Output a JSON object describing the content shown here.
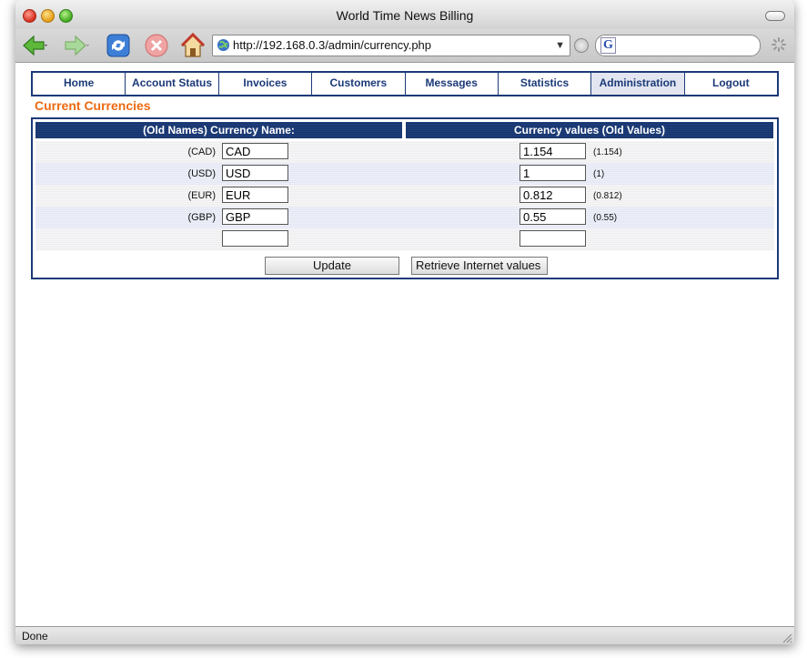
{
  "window": {
    "title": "World Time News Billing"
  },
  "browser": {
    "url": "http://192.168.0.3/admin/currency.php",
    "status": "Done"
  },
  "nav": {
    "items": [
      {
        "label": "Home"
      },
      {
        "label": "Account Status"
      },
      {
        "label": "Invoices"
      },
      {
        "label": "Customers"
      },
      {
        "label": "Messages"
      },
      {
        "label": "Statistics"
      },
      {
        "label": "Administration"
      },
      {
        "label": "Logout"
      }
    ]
  },
  "page": {
    "title": "Current Currencies",
    "col_name_header": "(Old Names) Currency Name:",
    "col_value_header": "Currency values (Old Values)",
    "rows": [
      {
        "old_name": "(CAD)",
        "name": "CAD",
        "value": "1.154",
        "old_value": "(1.154)"
      },
      {
        "old_name": "(USD)",
        "name": "USD",
        "value": "1",
        "old_value": "(1)"
      },
      {
        "old_name": "(EUR)",
        "name": "EUR",
        "value": "0.812",
        "old_value": "(0.812)"
      },
      {
        "old_name": "(GBP)",
        "name": "GBP",
        "value": "0.55",
        "old_value": "(0.55)"
      },
      {
        "old_name": "",
        "name": "",
        "value": "",
        "old_value": ""
      }
    ],
    "update_label": "Update",
    "retrieve_label": "Retrieve Internet values"
  },
  "colors": {
    "brand_blue": "#1c3a78",
    "title_orange": "#ec6a12"
  }
}
